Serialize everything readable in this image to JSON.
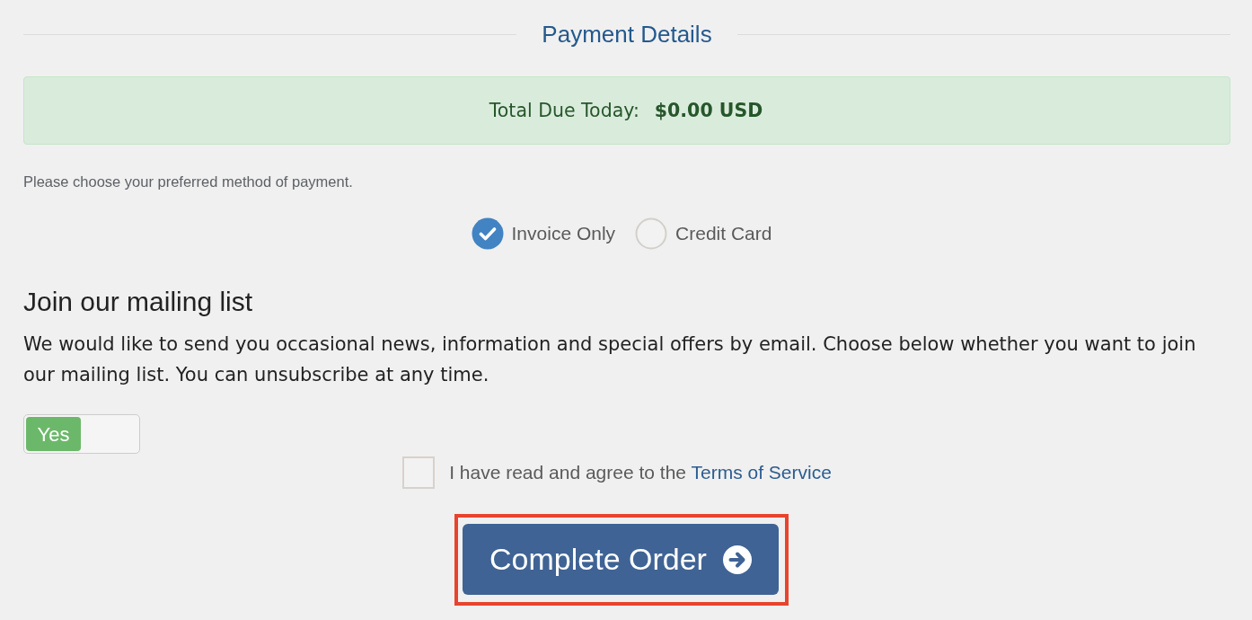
{
  "section": {
    "title": "Payment Details"
  },
  "total": {
    "label": "Total Due Today:",
    "amount": "$0.00 USD"
  },
  "payment_prompt": "Please choose your preferred method of payment.",
  "payment_methods": [
    {
      "label": "Invoice Only",
      "selected": true
    },
    {
      "label": "Credit Card",
      "selected": false
    }
  ],
  "mailing_list": {
    "title": "Join our mailing list",
    "description": "We would like to send you occasional news, information and special offers by email. Choose below whether you want to join our mailing list. You can unsubscribe at any time.",
    "toggle": {
      "label": "Yes",
      "on": true
    }
  },
  "terms": {
    "text": "I have read and agree to the",
    "link": "Terms of Service",
    "checked": false
  },
  "submit": {
    "label": "Complete Order",
    "highlighted": true
  }
}
